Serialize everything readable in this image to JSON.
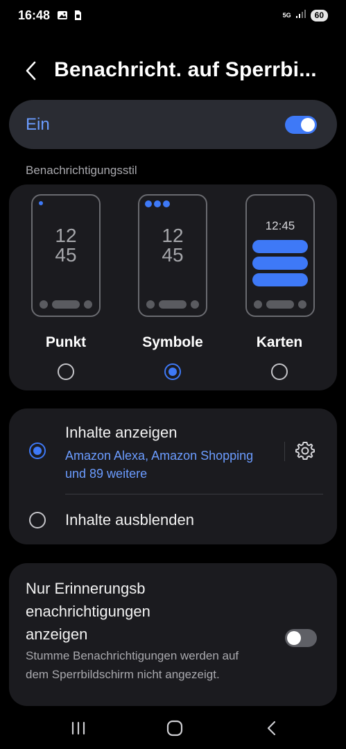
{
  "status_bar": {
    "time": "16:48",
    "network": "5G",
    "battery": "60"
  },
  "header": {
    "title": "Benachricht. auf Sperrbi..."
  },
  "master_switch": {
    "label": "Ein",
    "on": true
  },
  "style_section": {
    "label": "Benachrichtigungsstil",
    "options": [
      {
        "name": "Punkt",
        "clock": [
          "12",
          "45"
        ],
        "selected": false
      },
      {
        "name": "Symbole",
        "clock": [
          "12",
          "45"
        ],
        "selected": true
      },
      {
        "name": "Karten",
        "clock": "12:45",
        "selected": false
      }
    ]
  },
  "content_options": {
    "show": {
      "title": "Inhalte anzeigen",
      "subtitle": "Amazon Alexa, Amazon Shopping und 89 weitere",
      "selected": true
    },
    "hide": {
      "title": "Inhalte ausblenden",
      "selected": false
    }
  },
  "reminder": {
    "title": "Nur Erinnerungsb enachrichtigungen anzeigen",
    "description": "Stumme Benachrichtigungen werden auf dem Sperrbildschirm nicht angezeigt.",
    "on": false
  },
  "colors": {
    "accent": "#3e79f7",
    "accent_text": "#6b9cff",
    "card": "#1b1b1f",
    "background": "#000000"
  },
  "icons": [
    "gallery-icon",
    "sim-icon",
    "signal-icon",
    "back-arrow-icon",
    "gear-icon",
    "recents-icon",
    "home-icon",
    "nav-back-icon"
  ]
}
